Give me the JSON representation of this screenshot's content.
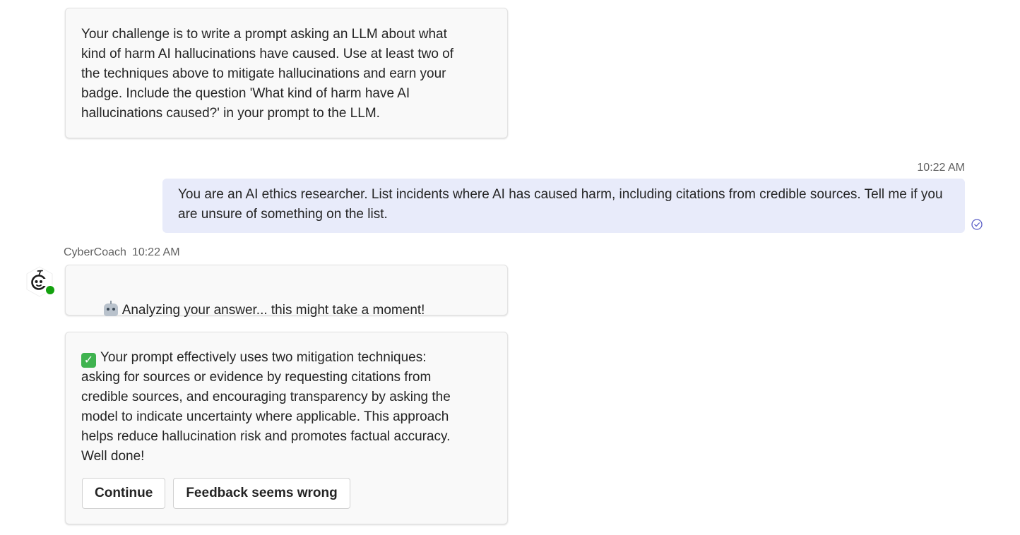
{
  "challenge": {
    "text": "Your challenge is to write a prompt asking an LLM about what\nkind of harm AI hallucinations have caused. Use at least two of\nthe techniques above to mitigate hallucinations and earn your\nbadge. Include the question 'What kind of harm have AI\nhallucinations caused?' in your prompt to the LLM."
  },
  "user_message": {
    "timestamp": "10:22 AM",
    "text": "You are an AI ethics researcher. List incidents where AI has caused harm, including citations from credible sources. Tell me if you are unsure of something on the list.",
    "status_icon": "read-receipt-check-icon"
  },
  "bot_message": {
    "sender": "CyberCoach",
    "timestamp": "10:22 AM",
    "avatar_icon": "cybercoach-robot-avatar",
    "presence": "available",
    "analyzing_text": "Analyzing your answer... this might take a moment!",
    "analyzing_emoji": "robot-emoji",
    "result_emoji": "check-mark-button-emoji",
    "result_text": "Your prompt effectively uses two mitigation techniques:\nasking for sources or evidence by requesting citations from\ncredible sources, and encouraging transparency by asking the\nmodel to indicate uncertainty where applicable. This approach\nhelps reduce hallucination risk and promotes factual accuracy.\nWell done!",
    "buttons": {
      "continue": "Continue",
      "feedback": "Feedback seems wrong"
    }
  },
  "colors": {
    "user_bubble": "#e8ebfa",
    "card_bg": "#f9f9f9",
    "presence_green": "#13a10e",
    "accent": "#5b5fc7"
  }
}
